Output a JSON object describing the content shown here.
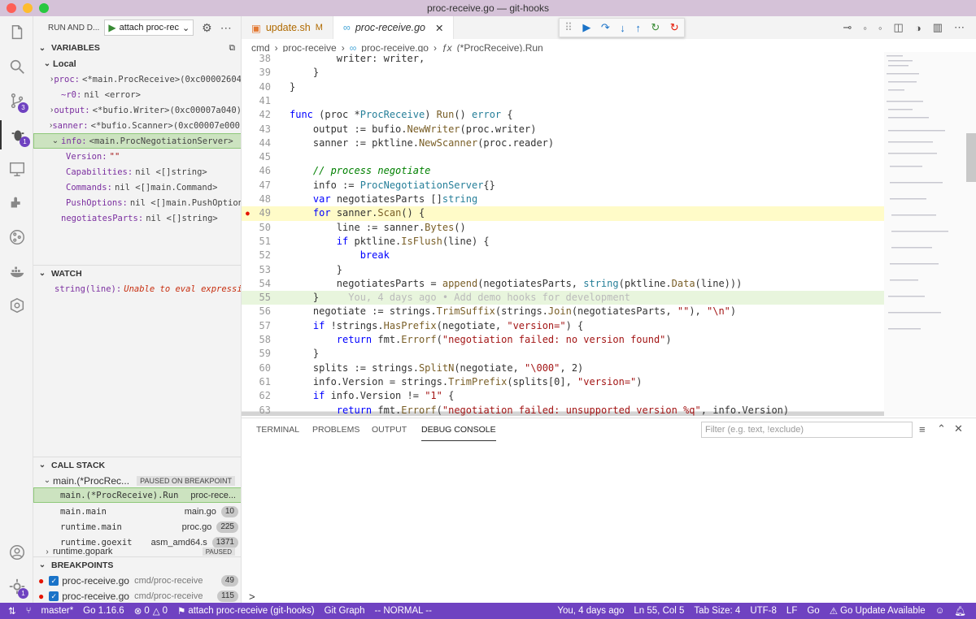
{
  "window": {
    "title": "proc-receive.go — git-hooks"
  },
  "colors": {
    "accent": "#6f42c1",
    "current_line": "#fffbc8",
    "breakpoint": "#e51400"
  },
  "activity": {
    "scm_badge": "3",
    "debug_badge": "1",
    "settings_badge": "1"
  },
  "sidebar": {
    "run_label": "RUN AND D...",
    "config": "attach proc-rec",
    "variables": {
      "title": "VARIABLES",
      "local": "Local",
      "items": [
        {
          "name": "proc:",
          "value": "<*main.ProcReceive>(0xc00002604"
        },
        {
          "name": "~r0:",
          "value": "nil <error>"
        },
        {
          "name": "output:",
          "value": "<*bufio.Writer>(0xc00007a040)"
        },
        {
          "name": "sanner:",
          "value": "<*bufio.Scanner>(0xc00007e000)"
        },
        {
          "name": "info:",
          "value": "<main.ProcNegotiationServer>"
        },
        {
          "name": "Version:",
          "value": "\"\""
        },
        {
          "name": "Capabilities:",
          "value": "nil <[]string>"
        },
        {
          "name": "Commands:",
          "value": "nil <[]main.Command>"
        },
        {
          "name": "PushOptions:",
          "value": "nil <[]main.PushOption>"
        },
        {
          "name": "negotiatesParts:",
          "value": "nil <[]string>"
        }
      ]
    },
    "watch": {
      "title": "WATCH",
      "expr": "string(line):",
      "value": "Unable to eval expressio..."
    },
    "callstack": {
      "title": "CALL STACK",
      "thread": "main.(*ProcRec...",
      "paused": "PAUSED ON BREAKPOINT",
      "frames": [
        {
          "fn": "main.(*ProcReceive).Run",
          "file": "proc-rece...",
          "line": ""
        },
        {
          "fn": "main.main",
          "file": "main.go",
          "line": "10"
        },
        {
          "fn": "runtime.main",
          "file": "proc.go",
          "line": "225"
        },
        {
          "fn": "runtime.goexit",
          "file": "asm_amd64.s",
          "line": "1371"
        }
      ],
      "extra": "runtime.gopark",
      "extra_tag": "PAUSED"
    },
    "breakpoints": {
      "title": "BREAKPOINTS",
      "items": [
        {
          "file": "proc-receive.go",
          "dir": "cmd/proc-receive",
          "line": "49"
        },
        {
          "file": "proc-receive.go",
          "dir": "cmd/proc-receive",
          "line": "115"
        }
      ]
    }
  },
  "tabs": [
    {
      "label": "update.sh",
      "mod": "M"
    },
    {
      "label": "proc-receive.go"
    }
  ],
  "breadcrumbs": [
    "cmd",
    "proc-receive",
    "proc-receive.go",
    "(*ProcReceive).Run"
  ],
  "code": {
    "lines": [
      {
        "n": "38",
        "html": "        <span>writer: writer,</span>"
      },
      {
        "n": "39",
        "html": "    }"
      },
      {
        "n": "40",
        "html": "}"
      },
      {
        "n": "41",
        "html": ""
      },
      {
        "n": "42",
        "html": "<span class='kw'>func</span> (proc *<span class='ty'>ProcReceive</span>) <span class='fn'>Run</span>() <span class='ty'>error</span> {"
      },
      {
        "n": "43",
        "html": "    output := bufio.<span class='fn'>NewWriter</span>(proc.writer)"
      },
      {
        "n": "44",
        "html": "    sanner := pktline.<span class='fn'>NewScanner</span>(proc.reader)"
      },
      {
        "n": "45",
        "html": ""
      },
      {
        "n": "46",
        "html": "    <span class='cm'>// process negotiate</span>"
      },
      {
        "n": "47",
        "html": "    info := <span class='ty'>ProcNegotiationServer</span>{}"
      },
      {
        "n": "48",
        "html": "    <span class='kw'>var</span> negotiatesParts []<span class='ty'>string</span>"
      },
      {
        "n": "49",
        "html": "    <span class='kw'>for</span> sanner.<span class='fn'>Scan</span>() {"
      },
      {
        "n": "50",
        "html": "        line := sanner.<span class='fn'>Bytes</span>()"
      },
      {
        "n": "51",
        "html": "        <span class='kw'>if</span> pktline.<span class='fn'>IsFlush</span>(line) {"
      },
      {
        "n": "52",
        "html": "            <span class='kw'>break</span>"
      },
      {
        "n": "53",
        "html": "        }"
      },
      {
        "n": "54",
        "html": "        negotiatesParts = <span class='fn'>append</span>(negotiatesParts, <span class='ty'>string</span>(pktline.<span class='fn'>Data</span>(line)))"
      },
      {
        "n": "55",
        "html": "    }     <span style='color:#bbb'>You, 4 days ago • Add demo hooks for development</span>"
      },
      {
        "n": "56",
        "html": "    negotiate := strings.<span class='fn'>TrimSuffix</span>(strings.<span class='fn'>Join</span>(negotiatesParts, <span class='st'>\"\"</span>), <span class='st'>\"\\n\"</span>)"
      },
      {
        "n": "57",
        "html": "    <span class='kw'>if</span> !strings.<span class='fn'>HasPrefix</span>(negotiate, <span class='st'>\"version=\"</span>) {"
      },
      {
        "n": "58",
        "html": "        <span class='kw'>return</span> fmt.<span class='fn'>Errorf</span>(<span class='st'>\"negotiation failed: no version found\"</span>)"
      },
      {
        "n": "59",
        "html": "    }"
      },
      {
        "n": "60",
        "html": "    splits := strings.<span class='fn'>SplitN</span>(negotiate, <span class='st'>\"\\000\"</span>, 2)"
      },
      {
        "n": "61",
        "html": "    info.Version = strings.<span class='fn'>TrimPrefix</span>(splits[0], <span class='st'>\"version=\"</span>)"
      },
      {
        "n": "62",
        "html": "    <span class='kw'>if</span> info.Version != <span class='st'>\"1\"</span> {"
      },
      {
        "n": "63",
        "html": "        <span class='kw'>return</span> fmt.<span class='fn'>Errorf</span>(<span class='st'>\"negotiation failed: unsupported version %q\"</span>, info.Version)"
      }
    ]
  },
  "panel": {
    "tabs": [
      "TERMINAL",
      "PROBLEMS",
      "OUTPUT",
      "DEBUG CONSOLE"
    ],
    "filter_placeholder": "Filter (e.g. text, !exclude)",
    "prompt": ">"
  },
  "status": {
    "branch": "master*",
    "go": "Go 1.16.6",
    "errors": "0",
    "warnings": "0",
    "debug": "attach proc-receive (git-hooks)",
    "graph": "Git Graph",
    "mode": "-- NORMAL --",
    "blame": "You, 4 days ago",
    "pos": "Ln 55, Col 5",
    "tab": "Tab Size: 4",
    "enc": "UTF-8",
    "eol": "LF",
    "lang": "Go",
    "update": "Go Update Available"
  }
}
